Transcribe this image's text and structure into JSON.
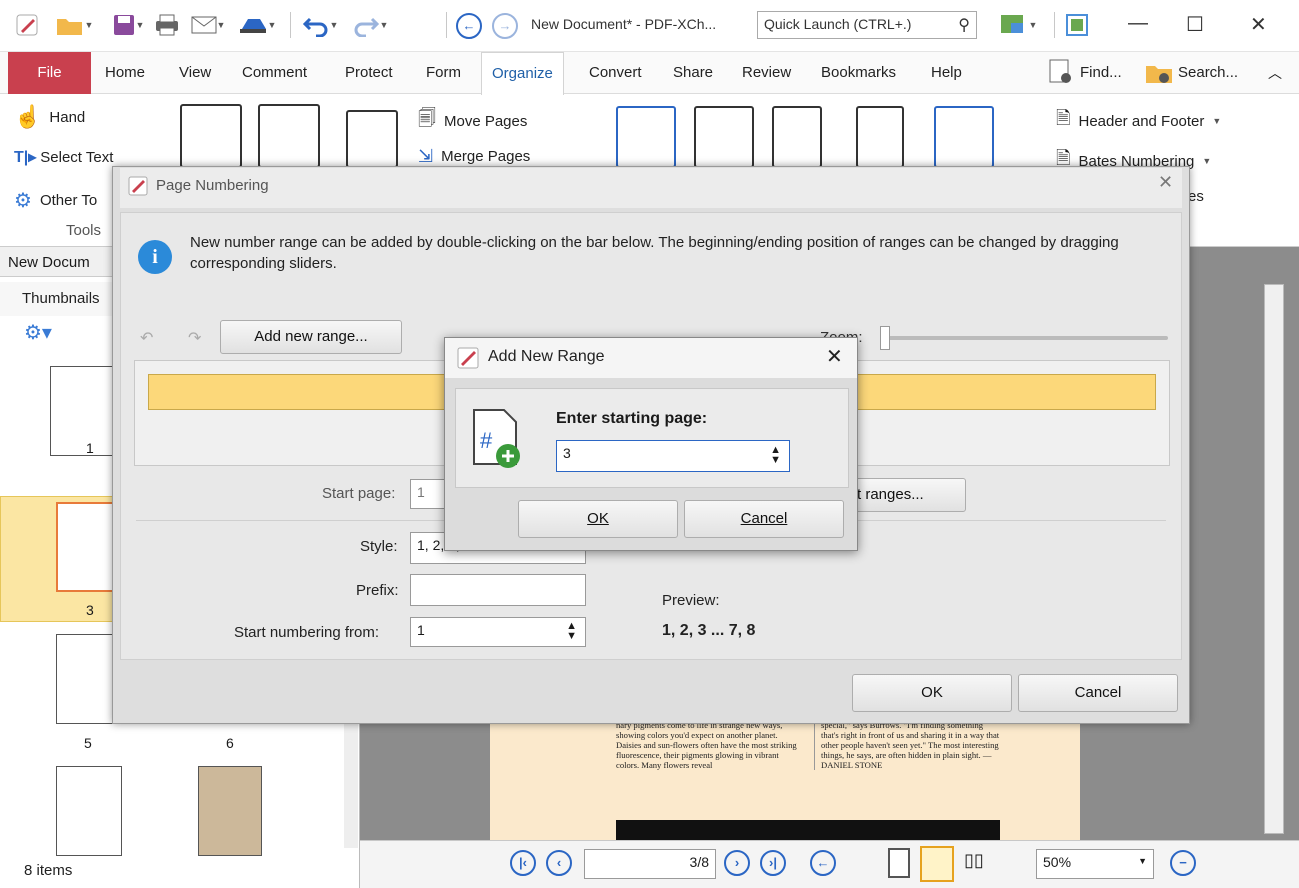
{
  "window": {
    "title": "New Document* - PDF-XCh...",
    "quick_launch_placeholder": "Quick Launch (CTRL+.)"
  },
  "menu": {
    "file": "File",
    "items": [
      "Home",
      "View",
      "Comment",
      "Protect",
      "Form",
      "Organize",
      "Convert",
      "Share",
      "Review",
      "Bookmarks",
      "Help"
    ],
    "active": "Organize",
    "find": "Find...",
    "search": "Search..."
  },
  "ribbon": {
    "hand": "Hand",
    "select_text": "Select Text",
    "other_tools": "Other To",
    "tools_group": "Tools",
    "move_pages": "Move Pages",
    "merge_pages": "Merge Pages",
    "header_footer": "Header and Footer",
    "bates_numbering": "Bates Numbering",
    "es": "es"
  },
  "left_panel": {
    "doc_tab": "New Docum",
    "thumbnails_tab": "Thumbnails",
    "page_labels": [
      "1",
      "3",
      "5",
      "6"
    ],
    "items_count": "8 items"
  },
  "page_numbering": {
    "title": "Page Numbering",
    "info": "New number range can be added by double-clicking on the bar below. The beginning/ending position of ranges can be changed by dragging corresponding sliders.",
    "add_range": "Add new range...",
    "zoom_label": "Zoom:",
    "start_page_label": "Start page:",
    "start_page_value": "1",
    "ranges_btn": "t ranges...",
    "style_label": "Style:",
    "style_value": "1, 2, 3, ...",
    "prefix_label": "Prefix:",
    "prefix_value": "",
    "start_from_label": "Start numbering from:",
    "start_from_value": "1",
    "preview_label": "Preview:",
    "preview_value": "1, 2, 3 ... 7, 8",
    "ok": "OK",
    "cancel": "Cancel"
  },
  "add_range": {
    "title": "Add New Range",
    "prompt": "Enter starting page:",
    "value": "3",
    "ok": "OK",
    "cancel": "Cancel"
  },
  "document_text": {
    "col1": "nary pigments come to life in strange new ways, showing colors you'd expect on another planet. Daisies and sun-flowers often have the most striking fluorescence, their pigments glowing in vibrant colors. Many flowers reveal",
    "col2": "special,\" says Burrows. \"I'm finding something that's right in front of us and sharing it in a way that other people haven't seen yet.\" The most interesting things, he says, are often hidden in plain sight. —DANIEL STONE"
  },
  "nav": {
    "page_field": "3/8",
    "zoom": "50%"
  },
  "colors": {
    "file_tab": "#c9404e",
    "accent": "#2b66c4",
    "range_bar": "#fcd87a"
  }
}
